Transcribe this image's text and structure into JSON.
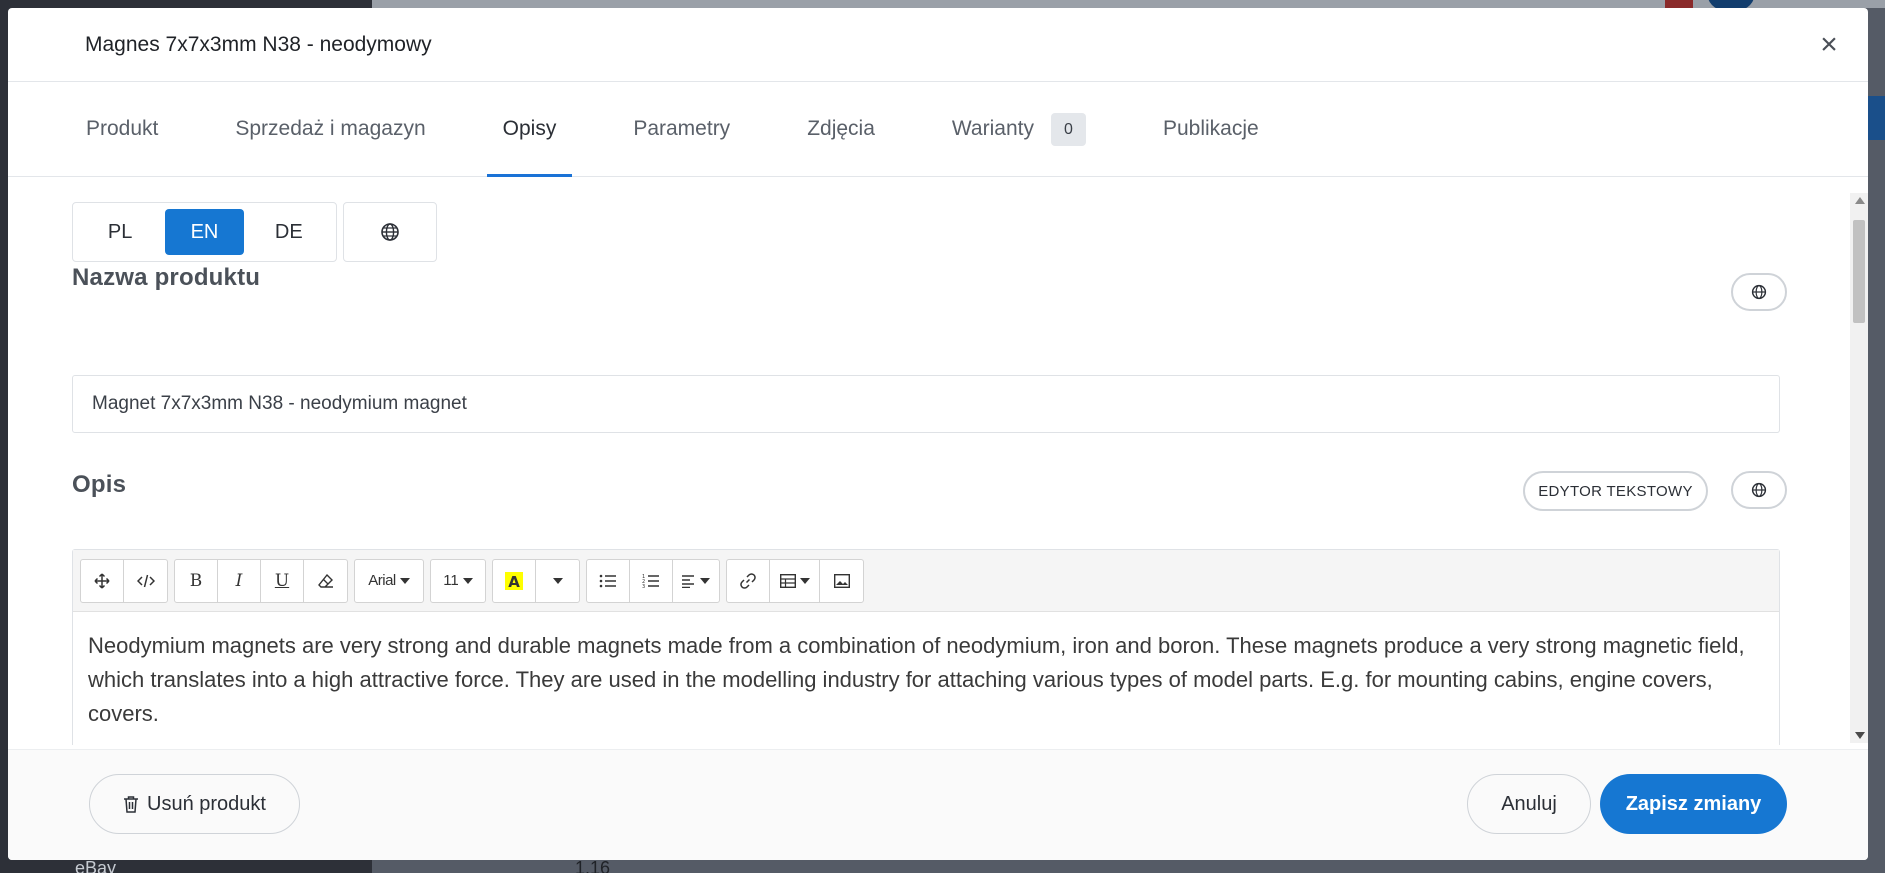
{
  "modal": {
    "title": "Magnes 7x7x3mm N38 - neodymowy",
    "close_glyph": "×"
  },
  "tabs": [
    {
      "label": "Produkt",
      "active": false
    },
    {
      "label": "Sprzedaż i magazyn",
      "active": false
    },
    {
      "label": "Opisy",
      "active": true
    },
    {
      "label": "Parametry",
      "active": false
    },
    {
      "label": "Zdjęcia",
      "active": false
    },
    {
      "label": "Warianty",
      "active": false,
      "count": "0"
    },
    {
      "label": "Publikacje",
      "active": false
    }
  ],
  "languages": {
    "items": [
      {
        "code": "PL",
        "active": false
      },
      {
        "code": "EN",
        "active": true
      },
      {
        "code": "DE",
        "active": false
      }
    ],
    "globe_icon": "globe-icon"
  },
  "product_name": {
    "section_title": "Nazwa produktu",
    "value": "Magnet 7x7x3mm N38 - neodymium magnet"
  },
  "description": {
    "section_title": "Opis",
    "editor_mode_label": "EDYTOR TEKSTOWY",
    "toolbar": {
      "font_name": "Arial",
      "font_size": "11"
    },
    "text": "Neodymium magnets are very strong and durable magnets made from a combination of neodymium, iron and boron. These magnets produce a very strong magnetic field, which translates into a high attractive force. They are used in the modelling industry for attaching various types of model parts. E.g. for mounting cabins, engine covers, covers."
  },
  "footer": {
    "delete_label": "Usuń produkt",
    "cancel_label": "Anuluj",
    "save_label": "Zapisz zmiany"
  },
  "background": {
    "bottom_value": "1,16",
    "bottom_left_text": "eBay"
  },
  "colors": {
    "accent": "#1677d2",
    "active_tab_underline": "#1a72d6"
  }
}
